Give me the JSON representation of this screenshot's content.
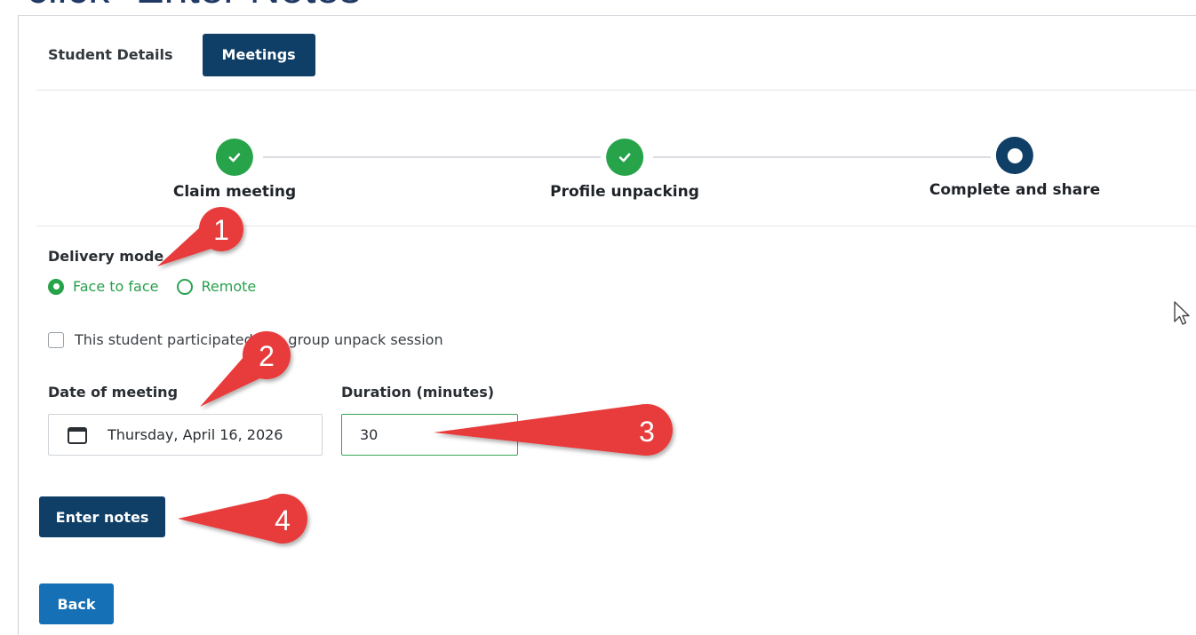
{
  "caption": "click “Enter Notes”",
  "tabs": [
    {
      "label": "Student Details",
      "active": false
    },
    {
      "label": "Meetings",
      "active": true
    }
  ],
  "steps": [
    {
      "label": "Claim meeting",
      "state": "done",
      "icon": "check-icon"
    },
    {
      "label": "Profile unpacking",
      "state": "done",
      "icon": "check-icon"
    },
    {
      "label": "Complete and share",
      "state": "current",
      "icon": "dot-icon"
    }
  ],
  "delivery_mode": {
    "label": "Delivery mode",
    "options": [
      {
        "label": "Face to face",
        "selected": true
      },
      {
        "label": "Remote",
        "selected": false
      }
    ]
  },
  "group_session": {
    "label": "This student participated in a group unpack session",
    "checked": false
  },
  "date_of_meeting": {
    "label": "Date of meeting",
    "value": "Thursday, April 16, 2026",
    "icon": "calendar-icon"
  },
  "duration": {
    "label": "Duration (minutes)",
    "value": "30"
  },
  "buttons": {
    "enter_notes": "Enter notes",
    "back": "Back"
  },
  "callouts": [
    "1",
    "2",
    "3",
    "4"
  ],
  "colors": {
    "primary": "#0f3e66",
    "success": "#27a34a",
    "back_button": "#1670b5",
    "callout": "#e83a3a"
  }
}
